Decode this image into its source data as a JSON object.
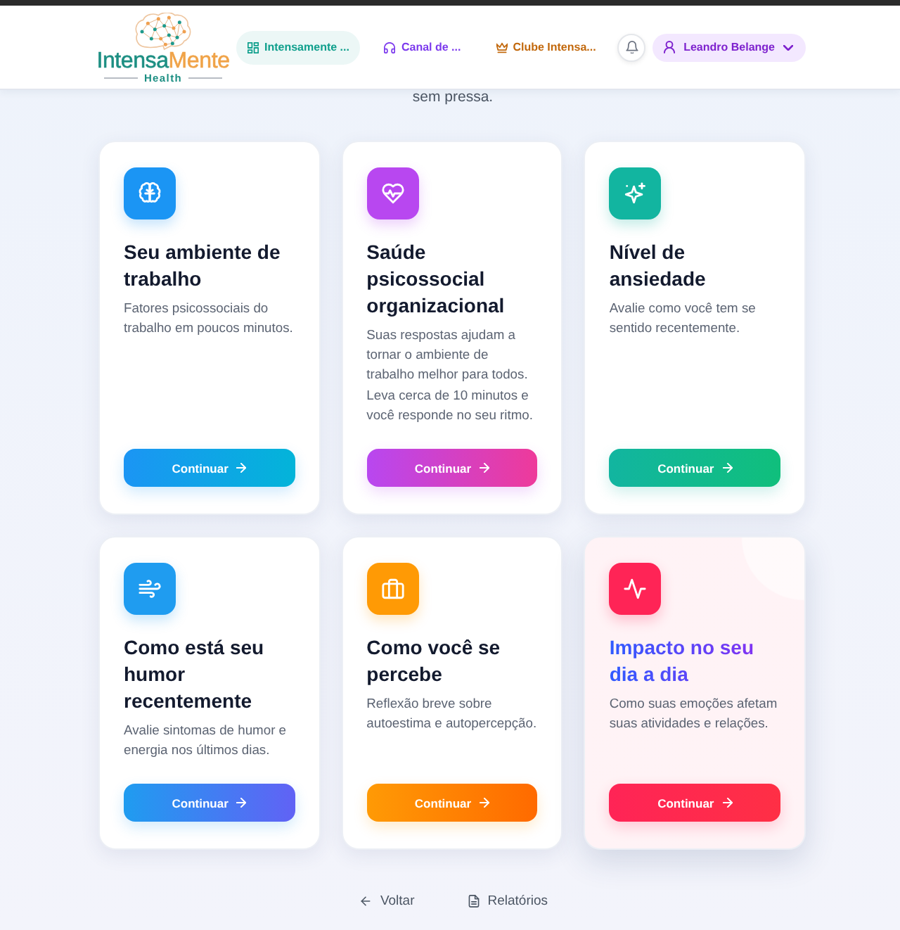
{
  "header": {
    "logo": {
      "name": [
        "Intensa",
        "Mente"
      ],
      "tagline": "Health"
    },
    "nav": [
      {
        "label": "Intensamente ...",
        "selected": true,
        "color": "#0f9f8c"
      },
      {
        "label": "Canal de ...",
        "selected": false,
        "color": "#7c3aed"
      },
      {
        "label": "Clube Intensa...",
        "selected": false,
        "color": "#c2680c"
      }
    ],
    "user": {
      "name": "Leandro Belange"
    }
  },
  "intro": {
    "text": "sem pressa."
  },
  "cards": [
    {
      "title": "Seu ambiente de trabalho",
      "description": "Fatores psicossociais do trabalho em poucos minutos.",
      "button": {
        "label": "Continuar",
        "color": "#03b4d9"
      },
      "color": "#1b95f4",
      "highlighted": false
    },
    {
      "title": "Saúde psicossocial organizacional",
      "description": "Suas respostas ajudam a tornar o ambiente de trabalho melhor para todos. Leva cerca de 10 minutos e você responde no seu ritmo.",
      "button": {
        "label": "Continuar",
        "color": "#ee3a9a"
      },
      "color": "#b847f0",
      "highlighted": false
    },
    {
      "title": "Nível de ansiedade",
      "description": "Avalie como você tem se sentido recentemente.",
      "button": {
        "label": "Continuar",
        "color": "#10bf7c"
      },
      "color": "#12b5a0",
      "highlighted": false
    },
    {
      "title": "Como está seu humor recentemente",
      "description": "Avalie sintomas de humor e energia nos últimos dias.",
      "button": {
        "label": "Continuar",
        "color": "#6162f5"
      },
      "color": "#1f9cf0",
      "highlighted": false
    },
    {
      "title": "Como você se percebe",
      "description": "Reflexão breve sobre autoestima e autopercepção.",
      "button": {
        "label": "Continuar",
        "color": "#ff6a00"
      },
      "color": "#ff9a05",
      "highlighted": false
    },
    {
      "title": "Impacto no seu dia a dia",
      "description": "Como suas emoções afetam suas atividades e relações.",
      "button": {
        "label": "Continuar",
        "color": "#ff2f45"
      },
      "color": "#ff2456",
      "highlighted": true
    }
  ],
  "footer": {
    "links": [
      {
        "label": "Voltar"
      },
      {
        "label": "Relatórios"
      }
    ]
  }
}
